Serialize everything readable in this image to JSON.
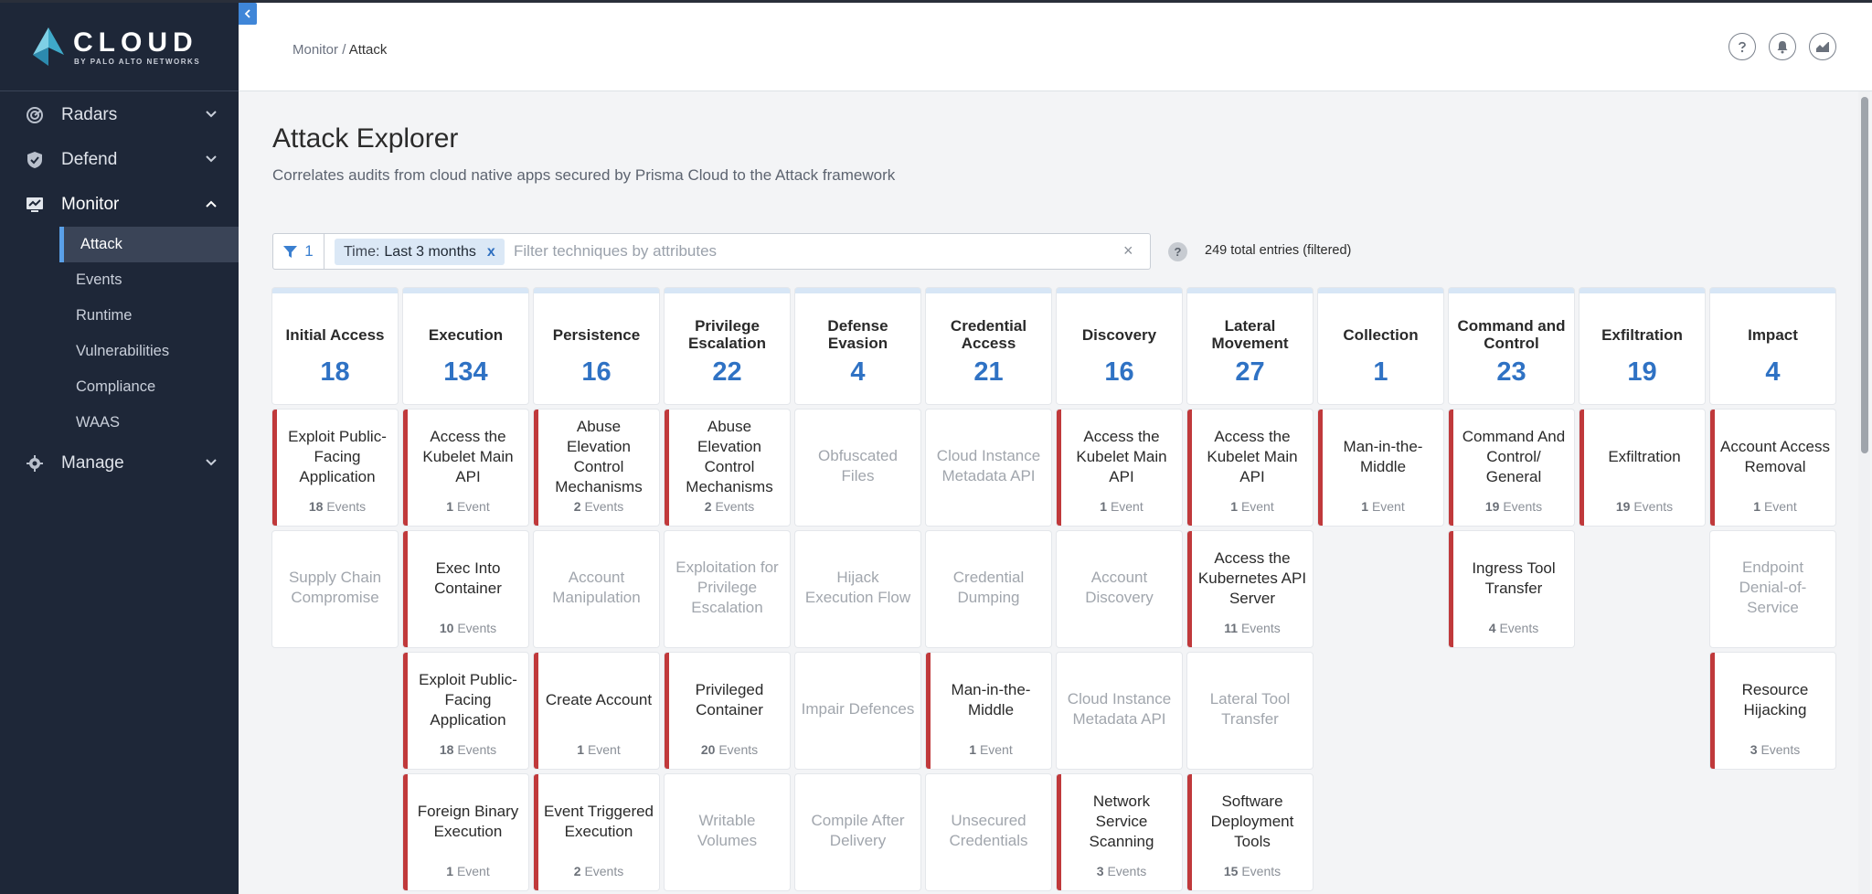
{
  "brand": {
    "name": "CLOUD",
    "sub": "BY PALO ALTO NETWORKS"
  },
  "nav": {
    "radars": "Radars",
    "defend": "Defend",
    "monitor": "Monitor",
    "monitor_items": [
      "Attack",
      "Events",
      "Runtime",
      "Vulnerabilities",
      "Compliance",
      "WAAS"
    ],
    "manage": "Manage"
  },
  "breadcrumb": {
    "parent": "Monitor",
    "separator": " / ",
    "current": "Attack"
  },
  "page": {
    "title": "Attack Explorer",
    "subtitle": "Correlates audits from cloud native apps secured by Prisma Cloud to the Attack framework"
  },
  "filter": {
    "count": "1",
    "chip_label": "Time:",
    "chip_value": "Last 3 months",
    "chip_remove": "x",
    "placeholder": "Filter techniques by attributes",
    "clear": "×",
    "help": "?",
    "total": "249 total entries (filtered)"
  },
  "colors": {
    "accent": "#2f72c4",
    "sidebar": "#1e2738",
    "hit_bar": "#c0393b"
  },
  "columns": [
    {
      "name": "Initial Access",
      "count": "18",
      "cards": [
        {
          "title": "Exploit Public-Facing Application",
          "num": "18",
          "unit": "Events",
          "hit": true
        },
        {
          "title": "Supply Chain Compromise",
          "num": "",
          "unit": "",
          "hit": false
        }
      ]
    },
    {
      "name": "Execution",
      "count": "134",
      "cards": [
        {
          "title": "Access the Kubelet Main API",
          "num": "1",
          "unit": "Event",
          "hit": true
        },
        {
          "title": "Exec Into Container",
          "num": "10",
          "unit": "Events",
          "hit": true
        },
        {
          "title": "Exploit Public-Facing Application",
          "num": "18",
          "unit": "Events",
          "hit": true
        },
        {
          "title": "Foreign Binary Execution",
          "num": "1",
          "unit": "Event",
          "hit": true
        }
      ]
    },
    {
      "name": "Persistence",
      "count": "16",
      "cards": [
        {
          "title": "Abuse Elevation Control Mechanisms",
          "num": "2",
          "unit": "Events",
          "hit": true
        },
        {
          "title": "Account Manipulation",
          "num": "",
          "unit": "",
          "hit": false
        },
        {
          "title": "Create Account",
          "num": "1",
          "unit": "Event",
          "hit": true
        },
        {
          "title": "Event Triggered Execution",
          "num": "2",
          "unit": "Events",
          "hit": true
        }
      ]
    },
    {
      "name": "Privilege Escalation",
      "count": "22",
      "cards": [
        {
          "title": "Abuse Elevation Control Mechanisms",
          "num": "2",
          "unit": "Events",
          "hit": true
        },
        {
          "title": "Exploitation for Privilege Escalation",
          "num": "",
          "unit": "",
          "hit": false
        },
        {
          "title": "Privileged Container",
          "num": "20",
          "unit": "Events",
          "hit": true
        },
        {
          "title": "Writable Volumes",
          "num": "",
          "unit": "",
          "hit": false
        }
      ]
    },
    {
      "name": "Defense Evasion",
      "count": "4",
      "cards": [
        {
          "title": "Obfuscated Files",
          "num": "",
          "unit": "",
          "hit": false
        },
        {
          "title": "Hijack Execution Flow",
          "num": "",
          "unit": "",
          "hit": false
        },
        {
          "title": "Impair Defences",
          "num": "",
          "unit": "",
          "hit": false
        },
        {
          "title": "Compile After Delivery",
          "num": "",
          "unit": "",
          "hit": false
        }
      ]
    },
    {
      "name": "Credential Access",
      "count": "21",
      "cards": [
        {
          "title": "Cloud Instance Metadata API",
          "num": "",
          "unit": "",
          "hit": false
        },
        {
          "title": "Credential Dumping",
          "num": "",
          "unit": "",
          "hit": false
        },
        {
          "title": "Man-in-the-Middle",
          "num": "1",
          "unit": "Event",
          "hit": true
        },
        {
          "title": "Unsecured Credentials",
          "num": "",
          "unit": "",
          "hit": false
        }
      ]
    },
    {
      "name": "Discovery",
      "count": "16",
      "cards": [
        {
          "title": "Access the Kubelet Main API",
          "num": "1",
          "unit": "Event",
          "hit": true
        },
        {
          "title": "Account Discovery",
          "num": "",
          "unit": "",
          "hit": false
        },
        {
          "title": "Cloud Instance Metadata API",
          "num": "",
          "unit": "",
          "hit": false
        },
        {
          "title": "Network Service Scanning",
          "num": "3",
          "unit": "Events",
          "hit": true
        }
      ]
    },
    {
      "name": "Lateral Movement",
      "count": "27",
      "cards": [
        {
          "title": "Access the Kubelet Main API",
          "num": "1",
          "unit": "Event",
          "hit": true
        },
        {
          "title": "Access the Kubernetes API Server",
          "num": "11",
          "unit": "Events",
          "hit": true
        },
        {
          "title": "Lateral Tool Transfer",
          "num": "",
          "unit": "",
          "hit": false
        },
        {
          "title": "Software Deployment Tools",
          "num": "15",
          "unit": "Events",
          "hit": true
        }
      ]
    },
    {
      "name": "Collection",
      "count": "1",
      "cards": [
        {
          "title": "Man-in-the-Middle",
          "num": "1",
          "unit": "Event",
          "hit": true
        }
      ]
    },
    {
      "name": "Command and Control",
      "count": "23",
      "cards": [
        {
          "title": "Command And Control/ General",
          "num": "19",
          "unit": "Events",
          "hit": true
        },
        {
          "title": "Ingress Tool Transfer",
          "num": "4",
          "unit": "Events",
          "hit": true
        }
      ]
    },
    {
      "name": "Exfiltration",
      "count": "19",
      "cards": [
        {
          "title": "Exfiltration",
          "num": "19",
          "unit": "Events",
          "hit": true
        }
      ]
    },
    {
      "name": "Impact",
      "count": "4",
      "cards": [
        {
          "title": "Account Access Removal",
          "num": "1",
          "unit": "Event",
          "hit": true
        },
        {
          "title": "Endpoint Denial-of-Service",
          "num": "",
          "unit": "",
          "hit": false
        },
        {
          "title": "Resource Hijacking",
          "num": "3",
          "unit": "Events",
          "hit": true
        }
      ]
    }
  ]
}
